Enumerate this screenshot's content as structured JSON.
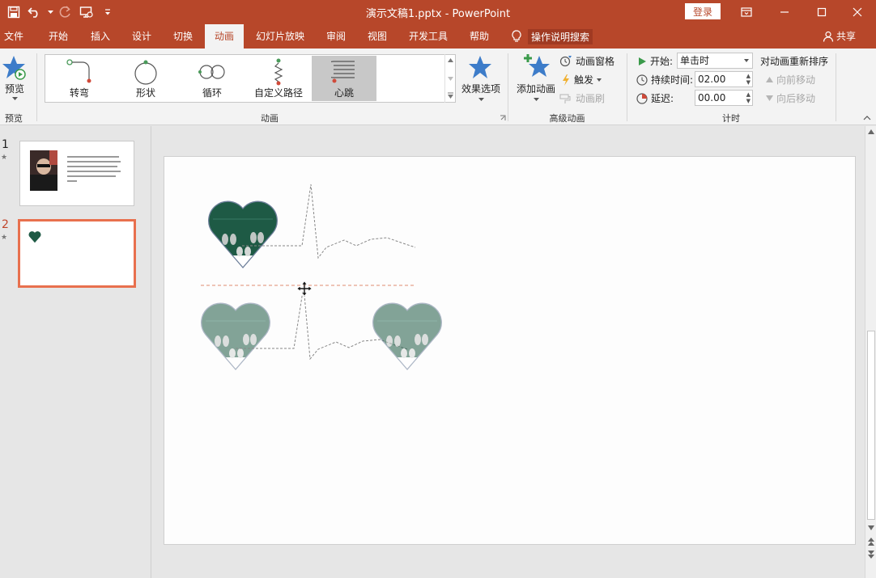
{
  "window": {
    "doc_title": "演示文稿1.pptx  -  PowerPoint",
    "login_label": "登录",
    "share_label": "共享"
  },
  "tabs": [
    {
      "label": "文件"
    },
    {
      "label": "开始"
    },
    {
      "label": "插入"
    },
    {
      "label": "设计"
    },
    {
      "label": "切换"
    },
    {
      "label": "动画",
      "active": true
    },
    {
      "label": "幻灯片放映"
    },
    {
      "label": "审阅"
    },
    {
      "label": "视图"
    },
    {
      "label": "开发工具"
    },
    {
      "label": "帮助"
    }
  ],
  "tell_me": "操作说明搜索",
  "ribbon": {
    "preview": {
      "button": "预览",
      "group": "预览"
    },
    "animation": {
      "group": "动画",
      "gallery": [
        {
          "label": "转弯",
          "icon": "turn-path-icon"
        },
        {
          "label": "形状",
          "icon": "shape-path-icon"
        },
        {
          "label": "循环",
          "icon": "loop-path-icon"
        },
        {
          "label": "自定义路径",
          "icon": "custom-path-icon"
        },
        {
          "label": "心跳",
          "icon": "heartbeat-path-icon",
          "selected": true
        }
      ],
      "effect_options": "效果选项"
    },
    "advanced": {
      "group": "高级动画",
      "add_animation": "添加动画",
      "animation_pane": "动画窗格",
      "trigger": "触发",
      "animation_painter": "动画刷"
    },
    "timing": {
      "group": "计时",
      "start_label": "开始:",
      "start_value": "单击时",
      "duration_label": "持续时间:",
      "duration_value": "02.00",
      "delay_label": "延迟:",
      "delay_value": "00.00",
      "reorder_title": "对动画重新排序",
      "move_earlier": "向前移动",
      "move_later": "向后移动"
    }
  },
  "slides_panel": [
    {
      "number": "1",
      "star": "★"
    },
    {
      "number": "2",
      "star": "★",
      "selected": true
    }
  ],
  "colors": {
    "brand": "#b7472a",
    "heart_fill": "#1e5a45",
    "path_line": "#888888",
    "guide_line": "#e08a70",
    "selected_thumb_border": "#e8704e"
  }
}
